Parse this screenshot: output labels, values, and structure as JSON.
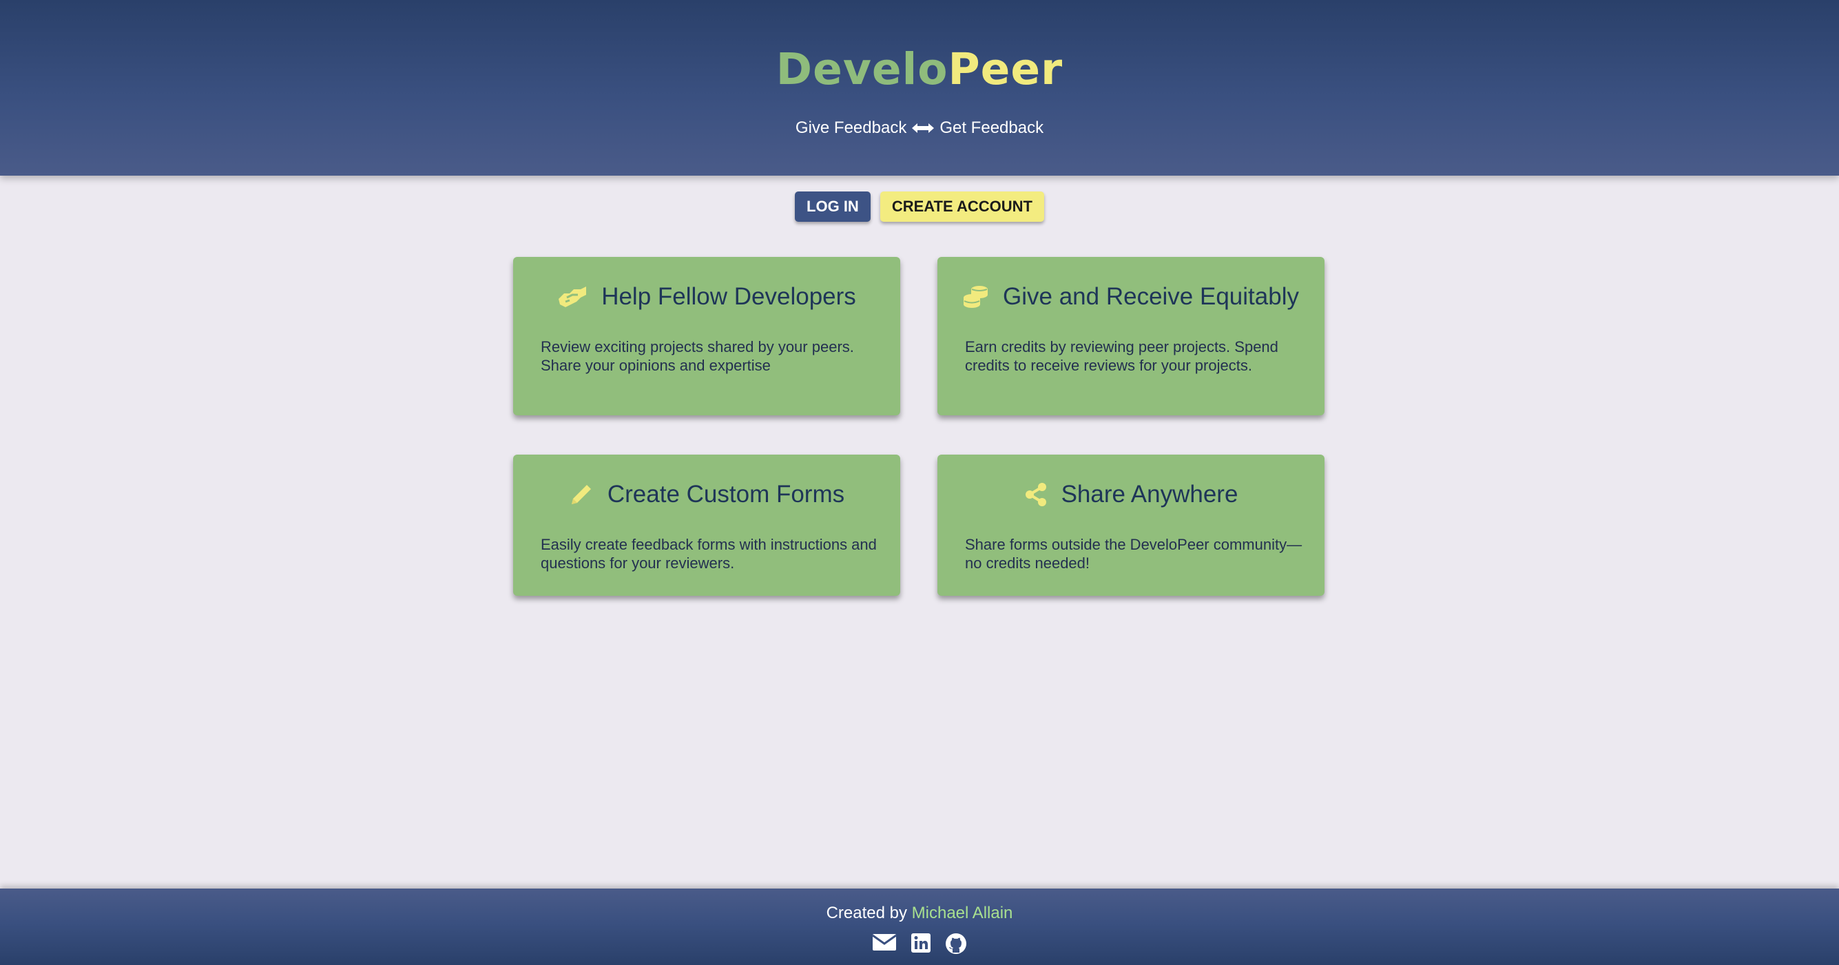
{
  "header": {
    "brand_part1": "Develo",
    "brand_part2": "Peer",
    "tagline_left": "Give Feedback",
    "tagline_icon": "left-right-arrow-icon",
    "tagline_right": "Get Feedback"
  },
  "auth": {
    "login_label": "LOG IN",
    "create_label": "CREATE ACCOUNT"
  },
  "features": [
    {
      "icon": "handshake-icon",
      "title": "Help Fellow Developers",
      "description": "Review exciting projects shared by your peers. Share your opinions and expertise"
    },
    {
      "icon": "coins-icon",
      "title": "Give and Receive Equitably",
      "description": "Earn credits by reviewing peer projects. Spend credits to receive reviews for your projects."
    },
    {
      "icon": "pencil-icon",
      "title": "Create Custom Forms",
      "description": "Easily create feedback forms with instructions and questions for your reviewers."
    },
    {
      "icon": "share-icon",
      "title": "Share Anywhere",
      "description": "Share forms outside the DeveloPeer community—no credits needed!"
    }
  ],
  "footer": {
    "created_by": "Created by ",
    "author": "Michael Allain",
    "social_icons": [
      "envelope-icon",
      "linkedin-icon",
      "github-icon"
    ]
  },
  "colors": {
    "header_bg": "#3a5080",
    "page_bg": "#ece9f0",
    "card_bg": "#91be7c",
    "accent_yellow": "#f1ea7e",
    "accent_green": "#8fbc7c",
    "card_title": "#1e3558"
  }
}
